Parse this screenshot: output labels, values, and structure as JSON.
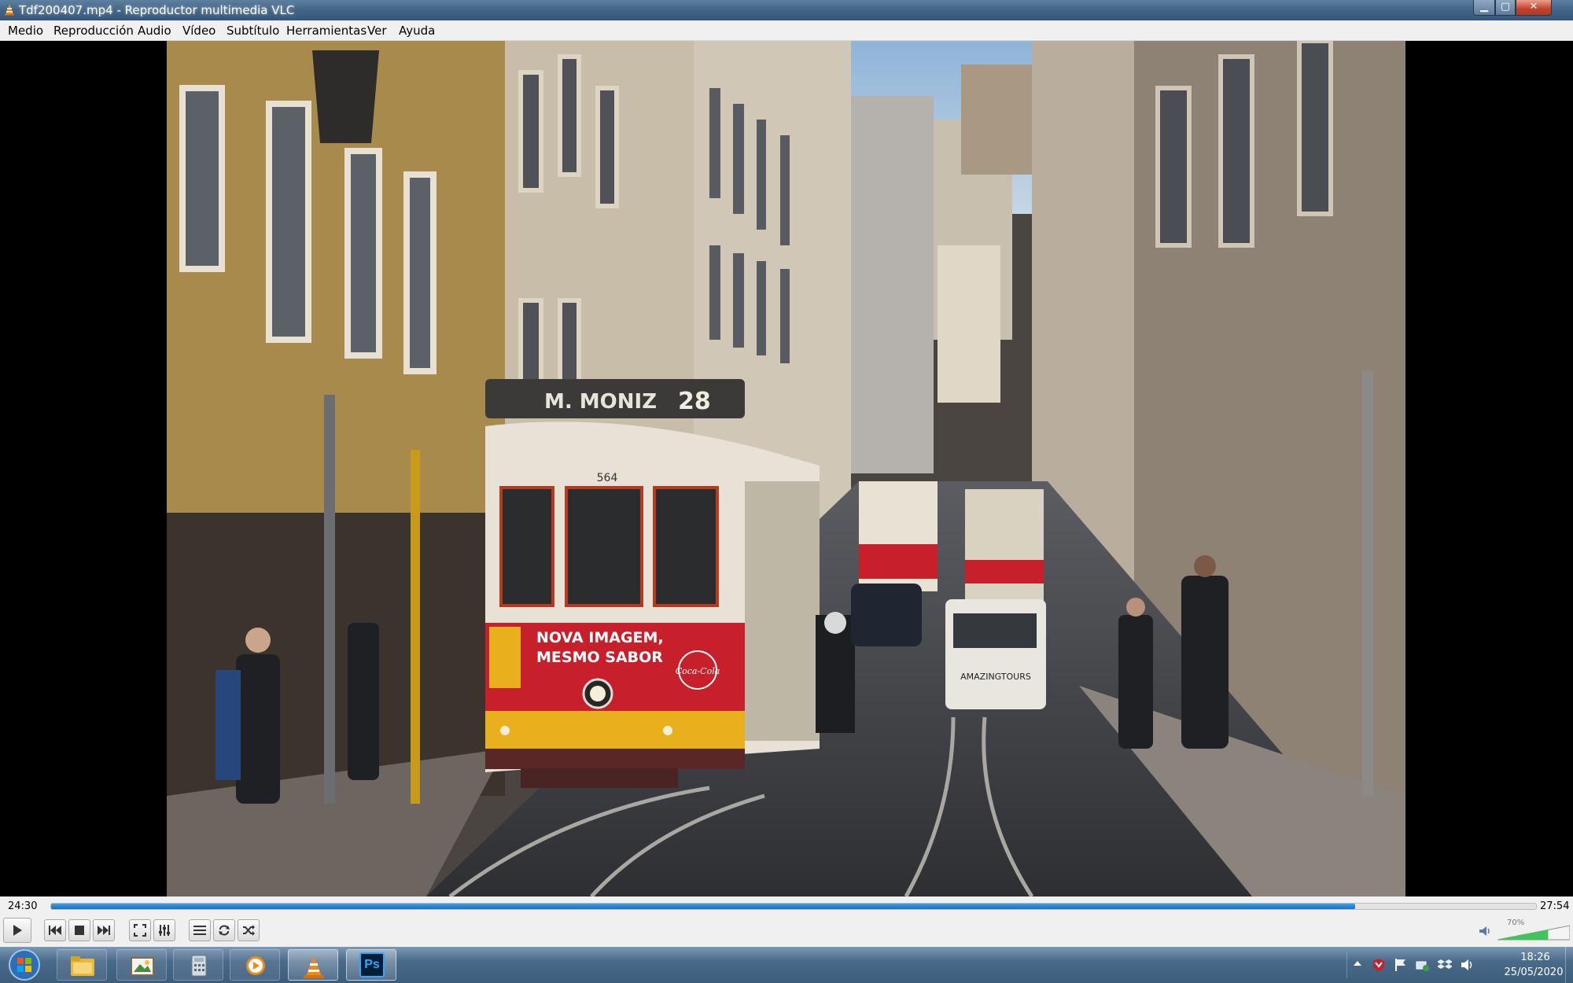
{
  "window": {
    "title": "Tdf200407.mp4 - Reproductor multimedia VLC",
    "minimize_label": "▁",
    "maximize_label": "▢",
    "close_label": "✕"
  },
  "menu": {
    "items": [
      {
        "label": "Medio"
      },
      {
        "label": "Reproducción"
      },
      {
        "label": "Audio"
      },
      {
        "label": "Vídeo"
      },
      {
        "label": "Subtítulo"
      },
      {
        "label": "Herramientas"
      },
      {
        "label": "Ver"
      },
      {
        "label": "Ayuda"
      }
    ]
  },
  "video": {
    "tram_route_name": "M. MONIZ",
    "tram_route_number": "28",
    "tram_car_number": "564",
    "tram_ad_line1": "NOVA IMAGEM,",
    "tram_ad_line2": "MESMO SABOR",
    "tram_ad_brand": "Coca-Cola",
    "tuktuk_plate": "AMAZINGTOURS"
  },
  "playback": {
    "elapsed": "24:30",
    "total": "27:54",
    "progress": 0.878
  },
  "controls": {
    "buttons": [
      {
        "name": "play-button",
        "icon": "play-icon"
      },
      {
        "name": "previous-button",
        "icon": "previous-icon"
      },
      {
        "name": "stop-button",
        "icon": "stop-icon"
      },
      {
        "name": "next-button",
        "icon": "next-icon"
      },
      {
        "name": "fullscreen-button",
        "icon": "fullscreen-icon"
      },
      {
        "name": "extended-settings-button",
        "icon": "equalizer-icon"
      },
      {
        "name": "playlist-button",
        "icon": "playlist-icon"
      },
      {
        "name": "loop-button",
        "icon": "loop-icon"
      },
      {
        "name": "random-button",
        "icon": "shuffle-icon"
      }
    ],
    "volume_percent": "70%",
    "volume_level": 0.7
  },
  "taskbar": {
    "apps": [
      {
        "name": "explorer",
        "icon": "folder-icon"
      },
      {
        "name": "photo-viewer",
        "icon": "photos-icon"
      },
      {
        "name": "calculator",
        "icon": "calculator-icon"
      },
      {
        "name": "media-player",
        "icon": "media-player-icon"
      },
      {
        "name": "vlc",
        "icon": "vlc-cone-icon",
        "active": true
      },
      {
        "name": "photoshop",
        "icon": "photoshop-icon",
        "label": "Ps"
      }
    ],
    "clock_time": "18:26",
    "clock_date": "25/05/2020"
  },
  "colors": {
    "seek_fill": "#1a6fc2",
    "tram_red": "#c8202a",
    "tram_yellow": "#e8b01c",
    "vlc_orange": "#f08a12"
  }
}
